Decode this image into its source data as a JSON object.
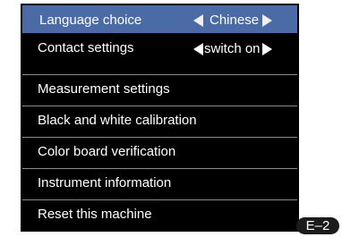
{
  "menu": {
    "items": [
      {
        "label": "Language choice",
        "value": "Chinese",
        "selected": true
      },
      {
        "label": "Contact settings",
        "value": "switch on",
        "selected": false
      },
      {
        "label": "Measurement settings"
      },
      {
        "label": "Black and white calibration"
      },
      {
        "label": "Color board verification"
      },
      {
        "label": "Instrument information"
      },
      {
        "label": "Reset this machine"
      }
    ]
  },
  "page_badge": "E–2",
  "colors": {
    "menu_background": "#000000",
    "selected_row": "#4a6ba6",
    "text": "#ffffff",
    "divider": "#8a8a8a"
  },
  "icons": {
    "prev": "triangle-left-icon",
    "next": "triangle-right-icon"
  }
}
